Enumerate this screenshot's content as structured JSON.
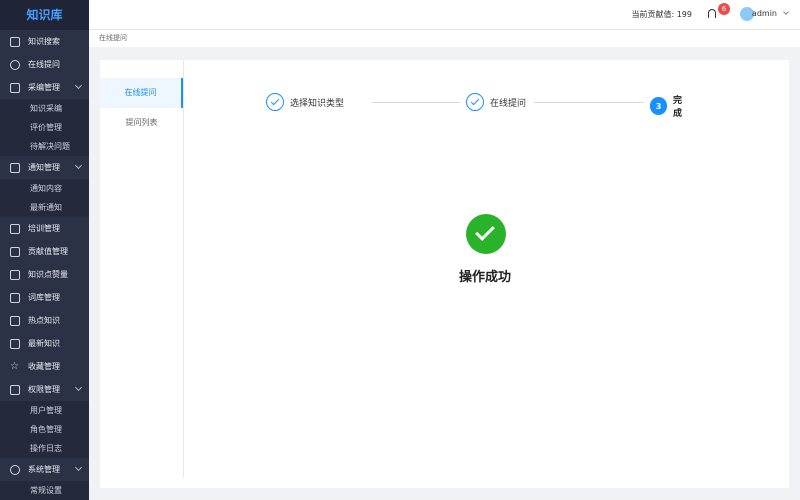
{
  "sidebar": {
    "brand": "知识库",
    "items": [
      {
        "label": "知识搜索"
      },
      {
        "label": "在线提问"
      },
      {
        "label": "采编管理"
      },
      {
        "label": "知识采编"
      },
      {
        "label": "评价管理"
      },
      {
        "label": "待解决问题"
      },
      {
        "label": "通知管理"
      },
      {
        "label": "通知内容"
      },
      {
        "label": "最新通知"
      },
      {
        "label": "培训管理"
      },
      {
        "label": "贡献值管理"
      },
      {
        "label": "知识点赞量"
      },
      {
        "label": "词库管理"
      },
      {
        "label": "热点知识"
      },
      {
        "label": "最新知识"
      },
      {
        "label": "收藏管理"
      },
      {
        "label": "权限管理"
      },
      {
        "label": "用户管理"
      },
      {
        "label": "角色管理"
      },
      {
        "label": "操作日志"
      },
      {
        "label": "系统管理"
      },
      {
        "label": "常规设置"
      }
    ]
  },
  "topbar": {
    "contribution_label": "当前贡献值: 199",
    "notification_count": "6",
    "username": "admin"
  },
  "breadcrumb": "在线提问",
  "subnav": {
    "items": [
      {
        "label": "在线提问"
      },
      {
        "label": "提问列表"
      }
    ]
  },
  "steps": [
    {
      "label": "选择知识类型"
    },
    {
      "label": "在线提问"
    },
    {
      "label": "完成",
      "index": "3"
    }
  ],
  "result": {
    "message": "操作成功"
  },
  "colors": {
    "sidebar_bg": "#2b3245",
    "accent": "#1890ff",
    "success": "#2bb22b",
    "badge": "#f04b4b"
  }
}
